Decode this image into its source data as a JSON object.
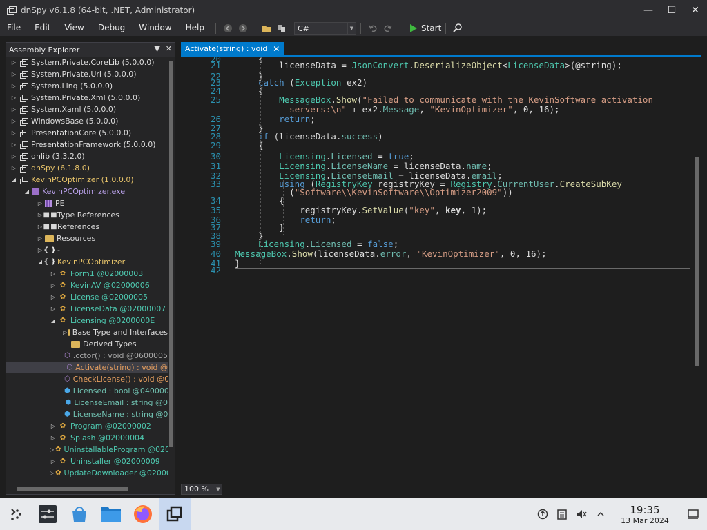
{
  "window": {
    "title": "dnSpy v6.1.8 (64-bit, .NET, Administrator)"
  },
  "menu": [
    "File",
    "Edit",
    "View",
    "Debug",
    "Window",
    "Help"
  ],
  "toolbar": {
    "language": "C#",
    "start_label": "Start"
  },
  "explorer": {
    "title": "Assembly Explorer",
    "rows": [
      {
        "label": "System.Private.CoreLib (5.0.0.0)",
        "icon": "assembly-icon",
        "toggle": "▷",
        "color": "white"
      },
      {
        "label": "System.Private.Uri (5.0.0.0)",
        "icon": "assembly-icon",
        "toggle": "▷",
        "color": "white"
      },
      {
        "label": "System.Linq (5.0.0.0)",
        "icon": "assembly-icon",
        "toggle": "▷",
        "color": "white"
      },
      {
        "label": "System.Private.Xml (5.0.0.0)",
        "icon": "assembly-icon",
        "toggle": "▷",
        "color": "white"
      },
      {
        "label": "System.Xaml (5.0.0.0)",
        "icon": "assembly-icon",
        "toggle": "▷",
        "color": "white"
      },
      {
        "label": "WindowsBase (5.0.0.0)",
        "icon": "assembly-icon",
        "toggle": "▷",
        "color": "white"
      },
      {
        "label": "PresentationCore (5.0.0.0)",
        "icon": "assembly-icon",
        "toggle": "▷",
        "color": "white"
      },
      {
        "label": "PresentationFramework (5.0.0.0)",
        "icon": "assembly-icon",
        "toggle": "▷",
        "color": "white"
      },
      {
        "label": "dnlib (3.3.2.0)",
        "icon": "assembly-icon",
        "toggle": "▷",
        "color": "white"
      },
      {
        "label": "dnSpy (6.1.8.0)",
        "icon": "assembly-icon",
        "toggle": "▷",
        "color": "yellow"
      },
      {
        "label": "KevinPCOptimizer (1.0.0.0)",
        "icon": "assembly-icon",
        "toggle": "◢",
        "color": "yellow"
      },
      {
        "label": "KevinPCOptimizer.exe",
        "icon": "module-icon",
        "toggle": "◢",
        "color": "purple"
      },
      {
        "label": "PE",
        "icon": "pe-icon",
        "toggle": "▷",
        "color": "white"
      },
      {
        "label": "Type References",
        "icon": "type-references-icon",
        "toggle": "▷",
        "color": "white"
      },
      {
        "label": "References",
        "icon": "references-icon",
        "toggle": "▷",
        "color": "white"
      },
      {
        "label": "Resources",
        "icon": "folder-icon",
        "toggle": "▷",
        "color": "white"
      },
      {
        "label": "-",
        "icon": "namespace-icon",
        "toggle": "▷",
        "color": "white"
      },
      {
        "label": "KevinPCOptimizer",
        "icon": "namespace-icon",
        "toggle": "◢",
        "color": "yellow"
      },
      {
        "label": "Form1 @02000003",
        "icon": "class-icon",
        "toggle": "▷",
        "color": "green"
      },
      {
        "label": "KevinAV @02000006",
        "icon": "class-icon",
        "toggle": "▷",
        "color": "green"
      },
      {
        "label": "License @02000005",
        "icon": "class-icon",
        "toggle": "▷",
        "color": "green"
      },
      {
        "label": "LicenseData @02000007",
        "icon": "class-icon",
        "toggle": "▷",
        "color": "green"
      },
      {
        "label": "Licensing @0200000E",
        "icon": "class-icon",
        "toggle": "◢",
        "color": "green"
      },
      {
        "label": "Base Type and Interfaces",
        "icon": "folder-icon",
        "toggle": "▷",
        "color": "white"
      },
      {
        "label": "Derived Types",
        "icon": "folder-icon",
        "toggle": "",
        "color": "white"
      },
      {
        "label": ".cctor() : void @0600005",
        "icon": "method-icon",
        "toggle": "",
        "color": "grey"
      },
      {
        "label": "Activate(string) : void @",
        "icon": "method-icon",
        "toggle": "",
        "color": "orange",
        "selected": true
      },
      {
        "label": "CheckLicense() : void @0",
        "icon": "method-icon",
        "toggle": "",
        "color": "orange"
      },
      {
        "label": "Licensed : bool @040000",
        "icon": "field-icon",
        "toggle": "",
        "color": "teal"
      },
      {
        "label": "LicenseEmail : string @0",
        "icon": "field-icon",
        "toggle": "",
        "color": "teal"
      },
      {
        "label": "LicenseName : string @0",
        "icon": "field-icon",
        "toggle": "",
        "color": "teal"
      },
      {
        "label": "Program @02000002",
        "icon": "class-icon",
        "toggle": "▷",
        "color": "green"
      },
      {
        "label": "Splash @02000004",
        "icon": "class-icon",
        "toggle": "▷",
        "color": "green"
      },
      {
        "label": "UninstallableProgram @0200",
        "icon": "class-icon",
        "toggle": "▷",
        "color": "green"
      },
      {
        "label": "Uninstaller @02000009",
        "icon": "class-icon",
        "toggle": "▷",
        "color": "green"
      },
      {
        "label": "UpdateDownloader @02000",
        "icon": "class-icon",
        "toggle": "▷",
        "color": "green"
      }
    ]
  },
  "tab": {
    "label": "Activate(string) : void"
  },
  "editor": {
    "zoom": "100 %",
    "lines": [
      {
        "n": "20",
        "html": "<span>{</span>"
      },
      {
        "n": "21",
        "html": "    licenseData = <span class='t'>JsonConvert</span>.<span class='m'>DeserializeObject</span>&lt;<span class='t'>LicenseData</span>&gt;(@string);"
      },
      {
        "n": "22",
        "html": "}"
      },
      {
        "n": "23",
        "html": "<span class='k'>catch</span> (<span class='t'>Exception</span> ex2)"
      },
      {
        "n": "24",
        "html": "{"
      },
      {
        "n": "25",
        "html": "    <span class='t'>MessageBox</span>.<span class='m'>Show</span>(<span class='s'>\"Failed to communicate with the KevinSoftware activation</span>"
      },
      {
        "n": "",
        "html": "      <span class='s'>servers:\\n\"</span> + ex2.<span class='p'>Message</span>, <span class='s'>\"KevinOptimizer\"</span>, 0, 16);"
      },
      {
        "n": "26",
        "html": "    <span class='k'>return</span>;"
      },
      {
        "n": "27",
        "html": "}"
      },
      {
        "n": "28",
        "html": "<span class='k'>if</span> (licenseData.<span class='p'>success</span>)"
      },
      {
        "n": "29",
        "html": "{"
      },
      {
        "n": "30",
        "html": "    <span class='t'>Licensing</span>.<span class='p'>Licensed</span> = <span class='k'>true</span>;"
      },
      {
        "n": "31",
        "html": "    <span class='t'>Licensing</span>.<span class='p'>LicenseName</span> = licenseData.<span class='p'>name</span>;"
      },
      {
        "n": "32",
        "html": "    <span class='t'>Licensing</span>.<span class='p'>LicenseEmail</span> = licenseData.<span class='p'>email</span>;"
      },
      {
        "n": "33",
        "html": "    <span class='k'>using</span> (<span class='t'>RegistryKey</span> registryKey = <span class='t'>Registry</span>.<span class='p'>CurrentUser</span>.<span class='m'>CreateSubKey</span>"
      },
      {
        "n": "",
        "html": "      (<span class='s'>\"Software\\\\KevinSoftware\\\\Optimizer2009\"</span>))"
      },
      {
        "n": "34",
        "html": "    {"
      },
      {
        "n": "35",
        "html": "        registryKey.<span class='m'>SetValue</span>(<span class='s'>\"key\"</span>, <b>key</b>, 1);"
      },
      {
        "n": "36",
        "html": "        <span class='k'>return</span>;"
      },
      {
        "n": "37",
        "html": "    }"
      },
      {
        "n": "38",
        "html": "}"
      },
      {
        "n": "39",
        "html": "<span class='t'>Licensing</span>.<span class='p'>Licensed</span> = <span class='k'>false</span>;"
      },
      {
        "n": "40",
        "html": "<span class='t'>MessageBox</span>.<span class='m'>Show</span>(licenseData.<span class='p'>error</span>, <span class='s'>\"KevinOptimizer\"</span>, 0, 16);"
      },
      {
        "n": "41",
        "html": "}"
      },
      {
        "n": "42",
        "html": ""
      }
    ]
  },
  "taskbar": {
    "time": "19:35",
    "date": "13 Mar 2024"
  }
}
